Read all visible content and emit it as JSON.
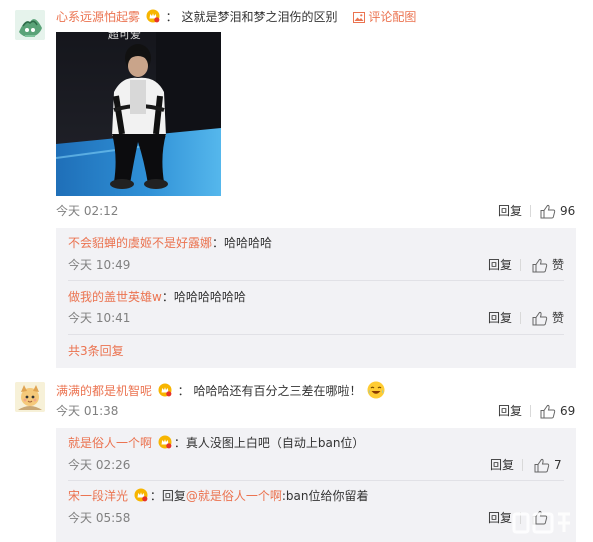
{
  "comments": [
    {
      "username": "心系远源怕起雾",
      "badge_icon": "vip-crown-badge-icon",
      "separator": "：",
      "text": "这就是梦泪和梦之泪伤的区别",
      "pic_link": "评论配图",
      "time": "今天 02:12",
      "reply_label": "回复",
      "like_count": "96",
      "replies": [
        {
          "username": "不会貂蝉的虞姬不是好露娜",
          "separator": "：",
          "text": "哈哈哈哈",
          "time": "今天 10:49",
          "reply_label": "回复",
          "like_label": "赞"
        },
        {
          "username": "做我的盖世英雄w",
          "separator": "：",
          "text": "哈哈哈哈哈哈",
          "time": "今天 10:41",
          "reply_label": "回复",
          "like_label": "赞"
        }
      ],
      "more_replies": "共3条回复"
    },
    {
      "username": "满满的都是机智呢",
      "badge_icon": "vip-crown-badge-icon",
      "separator": "：",
      "text": "哈哈哈还有百分之三差在哪啦！",
      "emoji": "laughing-tears-emoji",
      "time": "今天 01:38",
      "reply_label": "回复",
      "like_count": "69",
      "replies": [
        {
          "username": "就是俗人一个啊",
          "separator": "：",
          "text": "真人没图上白吧（自动上ban位）",
          "time": "今天 02:26",
          "reply_label": "回复",
          "like_count": "7"
        },
        {
          "username": "宋一段洋光",
          "separator": "：",
          "text": "回复",
          "mention": "@就是俗人一个啊",
          "text_after": ":ban位给你留着",
          "time": "今天 05:58",
          "reply_label": "回复"
        }
      ]
    }
  ],
  "colors": {
    "username": "#eb7350",
    "time": "#808080",
    "reply_bg": "#f2f2f5"
  }
}
